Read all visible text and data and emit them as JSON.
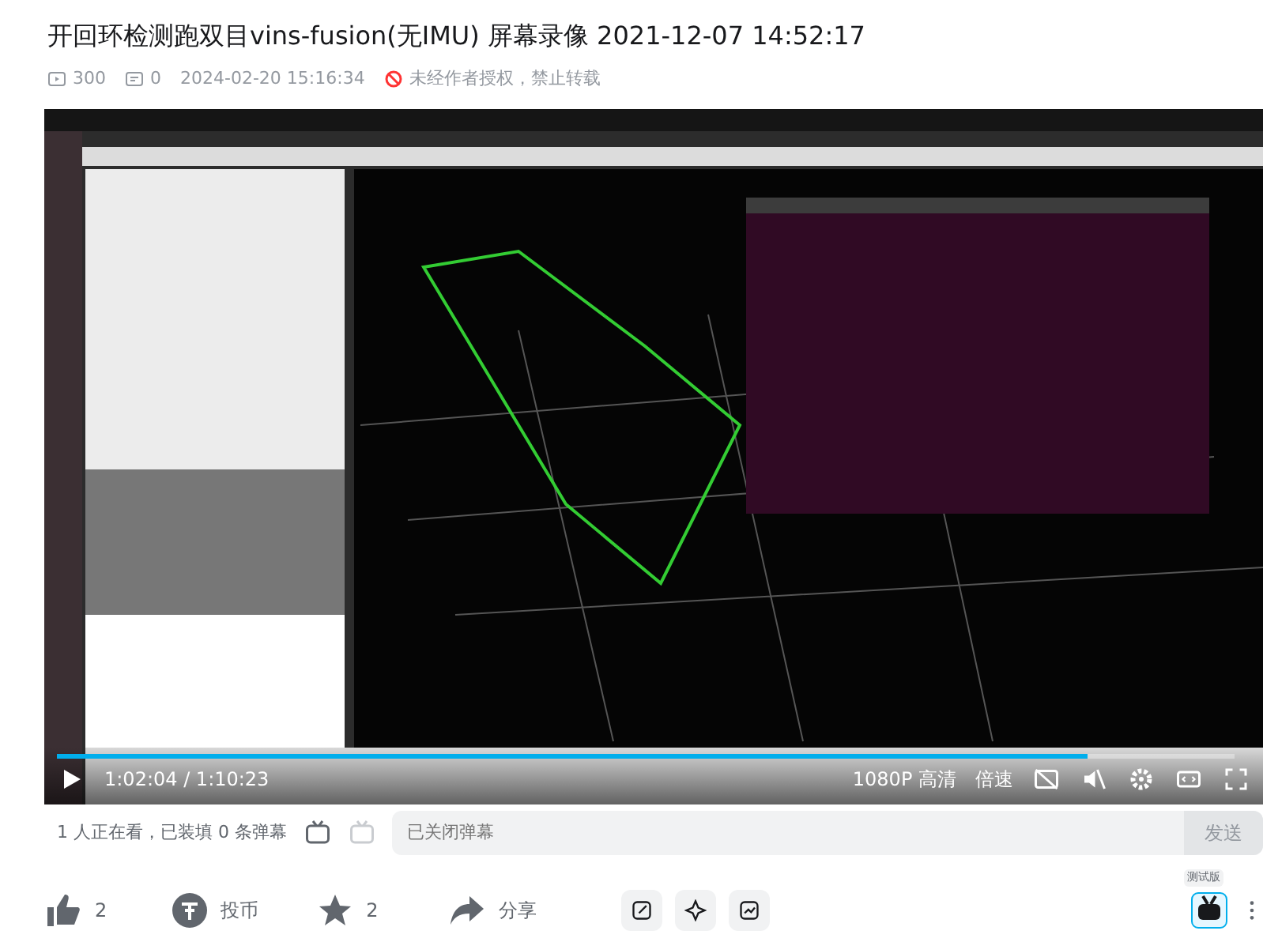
{
  "title": "开回环检测跑双目vins-fusion(无IMU) 屏幕录像 2021-12-07 14:52:17",
  "meta": {
    "views": "300",
    "comments": "0",
    "date": "2024-02-20 15:16:34",
    "notice": "未经作者授权，禁止转载"
  },
  "player": {
    "kind": "picture",
    "progress": {
      "level": 0.875
    },
    "time": "1:02:04 / 1:10:23",
    "quality": "1080P 高清",
    "speed": "倍速"
  },
  "danmaku": {
    "viewers": "1 人正在看，已装填 0 条弹幕",
    "placeholder": "已关闭弹幕",
    "send": "发送"
  },
  "actions": [
    {
      "kind": "like",
      "label": "2"
    },
    {
      "kind": "coin",
      "label": "投币"
    },
    {
      "kind": "star",
      "label": "2"
    },
    {
      "kind": "share",
      "label": "分享"
    }
  ],
  "badge": "测试版"
}
